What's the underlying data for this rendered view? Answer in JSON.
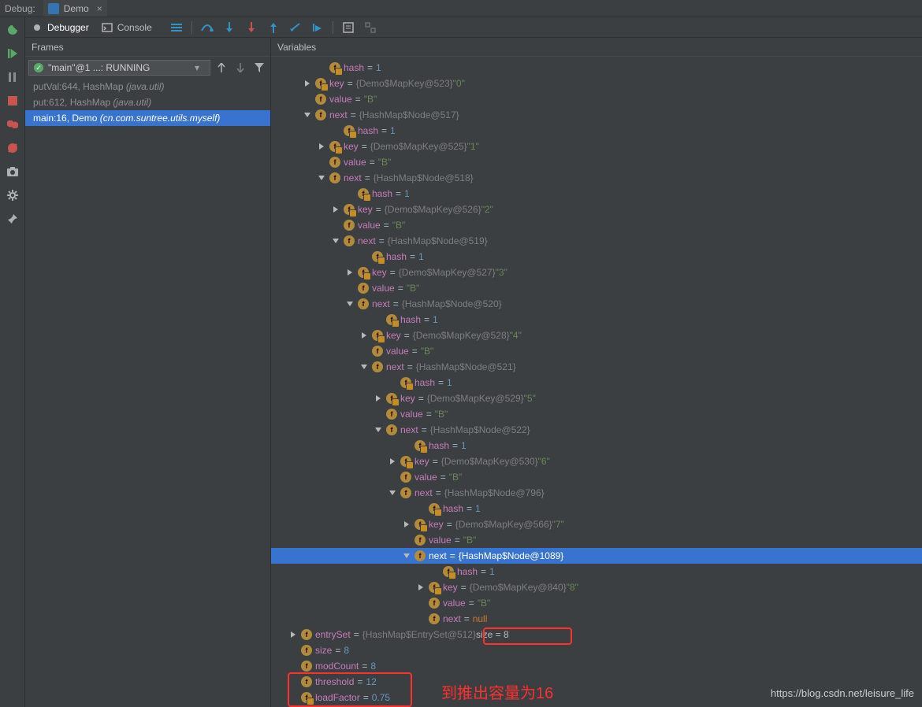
{
  "top": {
    "debug_label": "Debug:",
    "file_tab": "Demo"
  },
  "subtabs": {
    "debugger": "Debugger",
    "console": "Console"
  },
  "frames": {
    "header": "Frames",
    "thread": "\"main\"@1 ...: RUNNING",
    "stack": [
      {
        "text": "putVal:644, HashMap",
        "pkg": "(java.util)",
        "sel": false
      },
      {
        "text": "put:612, HashMap",
        "pkg": "(java.util)",
        "sel": false
      },
      {
        "text": "main:16, Demo",
        "pkg": "(cn.com.suntree.utils.myself)",
        "sel": true
      }
    ]
  },
  "vars": {
    "header": "Variables",
    "nodes": [
      {
        "indent": 3,
        "chev": "",
        "lock": true,
        "k": "hash",
        "eq": "=",
        "parts": [
          {
            "c": "num",
            "t": "1"
          }
        ]
      },
      {
        "indent": 2,
        "chev": "r",
        "lock": true,
        "k": "key",
        "eq": "=",
        "parts": [
          {
            "c": "cls",
            "t": "{Demo$MapKey@523}"
          },
          {
            "c": "",
            "t": " "
          },
          {
            "c": "str",
            "t": "\"0\""
          }
        ]
      },
      {
        "indent": 2,
        "chev": "",
        "lock": false,
        "k": "value",
        "eq": "=",
        "parts": [
          {
            "c": "str",
            "t": "\"B\""
          }
        ]
      },
      {
        "indent": 2,
        "chev": "d",
        "lock": false,
        "k": "next",
        "eq": "=",
        "parts": [
          {
            "c": "cls",
            "t": "{HashMap$Node@517}"
          }
        ]
      },
      {
        "indent": 4,
        "chev": "",
        "lock": true,
        "k": "hash",
        "eq": "=",
        "parts": [
          {
            "c": "num",
            "t": "1"
          }
        ]
      },
      {
        "indent": 3,
        "chev": "r",
        "lock": true,
        "k": "key",
        "eq": "=",
        "parts": [
          {
            "c": "cls",
            "t": "{Demo$MapKey@525}"
          },
          {
            "c": "",
            "t": " "
          },
          {
            "c": "str",
            "t": "\"1\""
          }
        ]
      },
      {
        "indent": 3,
        "chev": "",
        "lock": false,
        "k": "value",
        "eq": "=",
        "parts": [
          {
            "c": "str",
            "t": "\"B\""
          }
        ]
      },
      {
        "indent": 3,
        "chev": "d",
        "lock": false,
        "k": "next",
        "eq": "=",
        "parts": [
          {
            "c": "cls",
            "t": "{HashMap$Node@518}"
          }
        ]
      },
      {
        "indent": 5,
        "chev": "",
        "lock": true,
        "k": "hash",
        "eq": "=",
        "parts": [
          {
            "c": "num",
            "t": "1"
          }
        ]
      },
      {
        "indent": 4,
        "chev": "r",
        "lock": true,
        "k": "key",
        "eq": "=",
        "parts": [
          {
            "c": "cls",
            "t": "{Demo$MapKey@526}"
          },
          {
            "c": "",
            "t": " "
          },
          {
            "c": "str",
            "t": "\"2\""
          }
        ]
      },
      {
        "indent": 4,
        "chev": "",
        "lock": false,
        "k": "value",
        "eq": "=",
        "parts": [
          {
            "c": "str",
            "t": "\"B\""
          }
        ]
      },
      {
        "indent": 4,
        "chev": "d",
        "lock": false,
        "k": "next",
        "eq": "=",
        "parts": [
          {
            "c": "cls",
            "t": "{HashMap$Node@519}"
          }
        ]
      },
      {
        "indent": 6,
        "chev": "",
        "lock": true,
        "k": "hash",
        "eq": "=",
        "parts": [
          {
            "c": "num",
            "t": "1"
          }
        ]
      },
      {
        "indent": 5,
        "chev": "r",
        "lock": true,
        "k": "key",
        "eq": "=",
        "parts": [
          {
            "c": "cls",
            "t": "{Demo$MapKey@527}"
          },
          {
            "c": "",
            "t": " "
          },
          {
            "c": "str",
            "t": "\"3\""
          }
        ]
      },
      {
        "indent": 5,
        "chev": "",
        "lock": false,
        "k": "value",
        "eq": "=",
        "parts": [
          {
            "c": "str",
            "t": "\"B\""
          }
        ]
      },
      {
        "indent": 5,
        "chev": "d",
        "lock": false,
        "k": "next",
        "eq": "=",
        "parts": [
          {
            "c": "cls",
            "t": "{HashMap$Node@520}"
          }
        ]
      },
      {
        "indent": 7,
        "chev": "",
        "lock": true,
        "k": "hash",
        "eq": "=",
        "parts": [
          {
            "c": "num",
            "t": "1"
          }
        ]
      },
      {
        "indent": 6,
        "chev": "r",
        "lock": true,
        "k": "key",
        "eq": "=",
        "parts": [
          {
            "c": "cls",
            "t": "{Demo$MapKey@528}"
          },
          {
            "c": "",
            "t": " "
          },
          {
            "c": "str",
            "t": "\"4\""
          }
        ]
      },
      {
        "indent": 6,
        "chev": "",
        "lock": false,
        "k": "value",
        "eq": "=",
        "parts": [
          {
            "c": "str",
            "t": "\"B\""
          }
        ]
      },
      {
        "indent": 6,
        "chev": "d",
        "lock": false,
        "k": "next",
        "eq": "=",
        "parts": [
          {
            "c": "cls",
            "t": "{HashMap$Node@521}"
          }
        ]
      },
      {
        "indent": 8,
        "chev": "",
        "lock": true,
        "k": "hash",
        "eq": "=",
        "parts": [
          {
            "c": "num",
            "t": "1"
          }
        ]
      },
      {
        "indent": 7,
        "chev": "r",
        "lock": true,
        "k": "key",
        "eq": "=",
        "parts": [
          {
            "c": "cls",
            "t": "{Demo$MapKey@529}"
          },
          {
            "c": "",
            "t": " "
          },
          {
            "c": "str",
            "t": "\"5\""
          }
        ]
      },
      {
        "indent": 7,
        "chev": "",
        "lock": false,
        "k": "value",
        "eq": "=",
        "parts": [
          {
            "c": "str",
            "t": "\"B\""
          }
        ]
      },
      {
        "indent": 7,
        "chev": "d",
        "lock": false,
        "k": "next",
        "eq": "=",
        "parts": [
          {
            "c": "cls",
            "t": "{HashMap$Node@522}"
          }
        ]
      },
      {
        "indent": 9,
        "chev": "",
        "lock": true,
        "k": "hash",
        "eq": "=",
        "parts": [
          {
            "c": "num",
            "t": "1"
          }
        ]
      },
      {
        "indent": 8,
        "chev": "r",
        "lock": true,
        "k": "key",
        "eq": "=",
        "parts": [
          {
            "c": "cls",
            "t": "{Demo$MapKey@530}"
          },
          {
            "c": "",
            "t": " "
          },
          {
            "c": "str",
            "t": "\"6\""
          }
        ]
      },
      {
        "indent": 8,
        "chev": "",
        "lock": false,
        "k": "value",
        "eq": "=",
        "parts": [
          {
            "c": "str",
            "t": "\"B\""
          }
        ]
      },
      {
        "indent": 8,
        "chev": "d",
        "lock": false,
        "k": "next",
        "eq": "=",
        "parts": [
          {
            "c": "cls",
            "t": "{HashMap$Node@796}"
          }
        ]
      },
      {
        "indent": 10,
        "chev": "",
        "lock": true,
        "k": "hash",
        "eq": "=",
        "parts": [
          {
            "c": "num",
            "t": "1"
          }
        ]
      },
      {
        "indent": 9,
        "chev": "r",
        "lock": true,
        "k": "key",
        "eq": "=",
        "parts": [
          {
            "c": "cls",
            "t": "{Demo$MapKey@566}"
          },
          {
            "c": "",
            "t": " "
          },
          {
            "c": "str",
            "t": "\"7\""
          }
        ]
      },
      {
        "indent": 9,
        "chev": "",
        "lock": false,
        "k": "value",
        "eq": "=",
        "parts": [
          {
            "c": "str",
            "t": "\"B\""
          }
        ]
      },
      {
        "indent": 9,
        "chev": "d",
        "lock": false,
        "k": "next",
        "eq": "=",
        "parts": [
          {
            "c": "cls",
            "t": "{HashMap$Node@1089}"
          }
        ],
        "sel": true
      },
      {
        "indent": 11,
        "chev": "",
        "lock": true,
        "k": "hash",
        "eq": "=",
        "parts": [
          {
            "c": "num",
            "t": "1"
          }
        ]
      },
      {
        "indent": 10,
        "chev": "r",
        "lock": true,
        "k": "key",
        "eq": "=",
        "parts": [
          {
            "c": "cls",
            "t": "{Demo$MapKey@840}"
          },
          {
            "c": "",
            "t": " "
          },
          {
            "c": "str",
            "t": "\"8\""
          }
        ]
      },
      {
        "indent": 10,
        "chev": "",
        "lock": false,
        "k": "value",
        "eq": "=",
        "parts": [
          {
            "c": "str",
            "t": "\"B\""
          }
        ]
      },
      {
        "indent": 10,
        "chev": "",
        "lock": false,
        "k": "next",
        "eq": "=",
        "parts": [
          {
            "c": "kw",
            "t": "null"
          }
        ]
      },
      {
        "indent": 1,
        "chev": "r",
        "lock": false,
        "k": "entrySet",
        "eq": "=",
        "parts": [
          {
            "c": "cls",
            "t": "{HashMap$EntrySet@512}"
          },
          {
            "c": "",
            "t": "  size = 8"
          }
        ]
      },
      {
        "indent": 1,
        "chev": "",
        "lock": false,
        "k": "size",
        "eq": "=",
        "parts": [
          {
            "c": "num",
            "t": "8"
          }
        ]
      },
      {
        "indent": 1,
        "chev": "",
        "lock": false,
        "k": "modCount",
        "eq": "=",
        "parts": [
          {
            "c": "num",
            "t": "8"
          }
        ]
      },
      {
        "indent": 1,
        "chev": "",
        "lock": false,
        "k": "threshold",
        "eq": "=",
        "parts": [
          {
            "c": "num",
            "t": "12"
          }
        ]
      },
      {
        "indent": 1,
        "chev": "",
        "lock": true,
        "k": "loadFactor",
        "eq": "=",
        "parts": [
          {
            "c": "num",
            "t": "0.75"
          }
        ]
      }
    ],
    "annotation": "到推出容量为16",
    "watermark": "https://blog.csdn.net/leisure_life"
  }
}
